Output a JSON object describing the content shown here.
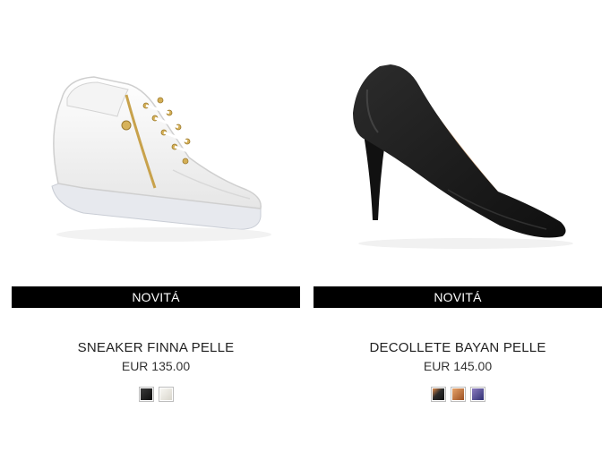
{
  "products": [
    {
      "badge": "NOVITÁ",
      "name": "SNEAKER FINNA PELLE",
      "price": "EUR 135.00",
      "swatches": [
        {
          "label": "black",
          "color": "#1b1b1b"
        },
        {
          "label": "white",
          "color": "#ecebe6"
        }
      ]
    },
    {
      "badge": "NOVITÁ",
      "name": "DECOLLETE BAYAN PELLE",
      "price": "EUR 145.00",
      "swatches": [
        {
          "label": "black",
          "color": "#222222"
        },
        {
          "label": "cognac",
          "color": "#b4622f"
        },
        {
          "label": "blue",
          "color": "#4b4d92"
        }
      ]
    }
  ]
}
